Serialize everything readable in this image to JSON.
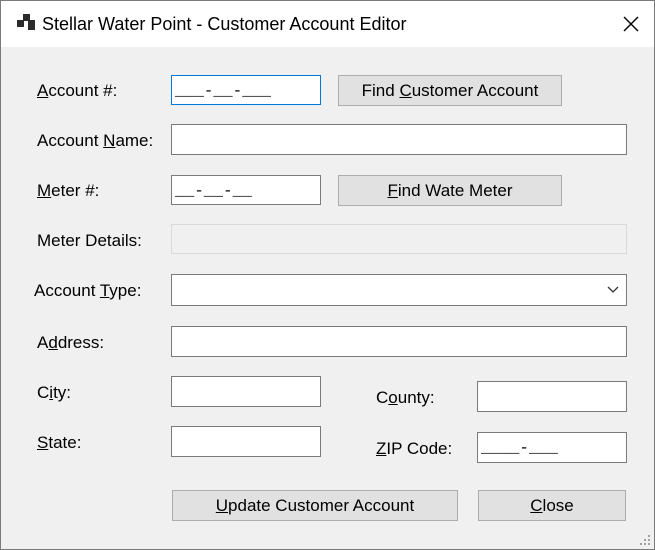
{
  "window": {
    "title": "Stellar Water Point - Customer Account Editor"
  },
  "icons": {
    "app": "app-window-icon",
    "close": "close-icon",
    "dropdown": "chevron-down-icon"
  },
  "form": {
    "account_number": {
      "label_pre": "",
      "label_key": "A",
      "label_post": "ccount #:",
      "mask": "___-__-___"
    },
    "account_name": {
      "label_pre": "Account ",
      "label_key": "N",
      "label_post": "ame:",
      "value": ""
    },
    "meter_number": {
      "label_pre": "",
      "label_key": "M",
      "label_post": "eter #:",
      "mask": "__-__-__"
    },
    "meter_details": {
      "label": "Meter Details:",
      "value": ""
    },
    "account_type": {
      "label_pre": "Account ",
      "label_key": "T",
      "label_post": "ype:",
      "selected": ""
    },
    "address": {
      "label_pre": "A",
      "label_key": "d",
      "label_post": "dress:",
      "value": ""
    },
    "city": {
      "label_pre": "C",
      "label_key": "i",
      "label_post": "ty:",
      "value": ""
    },
    "county": {
      "label_pre": "C",
      "label_key": "o",
      "label_post": "unty:",
      "value": ""
    },
    "state": {
      "label_pre": "",
      "label_key": "S",
      "label_post": "tate:",
      "value": ""
    },
    "zip_code": {
      "label_pre": "",
      "label_key": "Z",
      "label_post": "IP Code:",
      "mask": "____-___"
    }
  },
  "buttons": {
    "find_account": {
      "pre": "Find ",
      "key": "C",
      "post": "ustomer Account"
    },
    "find_meter": {
      "pre": "",
      "key": "F",
      "post": "ind Wate Meter"
    },
    "update_account": {
      "pre": "",
      "key": "U",
      "post": "pdate Customer Account"
    },
    "close": {
      "pre": "",
      "key": "C",
      "post": "lose"
    }
  }
}
